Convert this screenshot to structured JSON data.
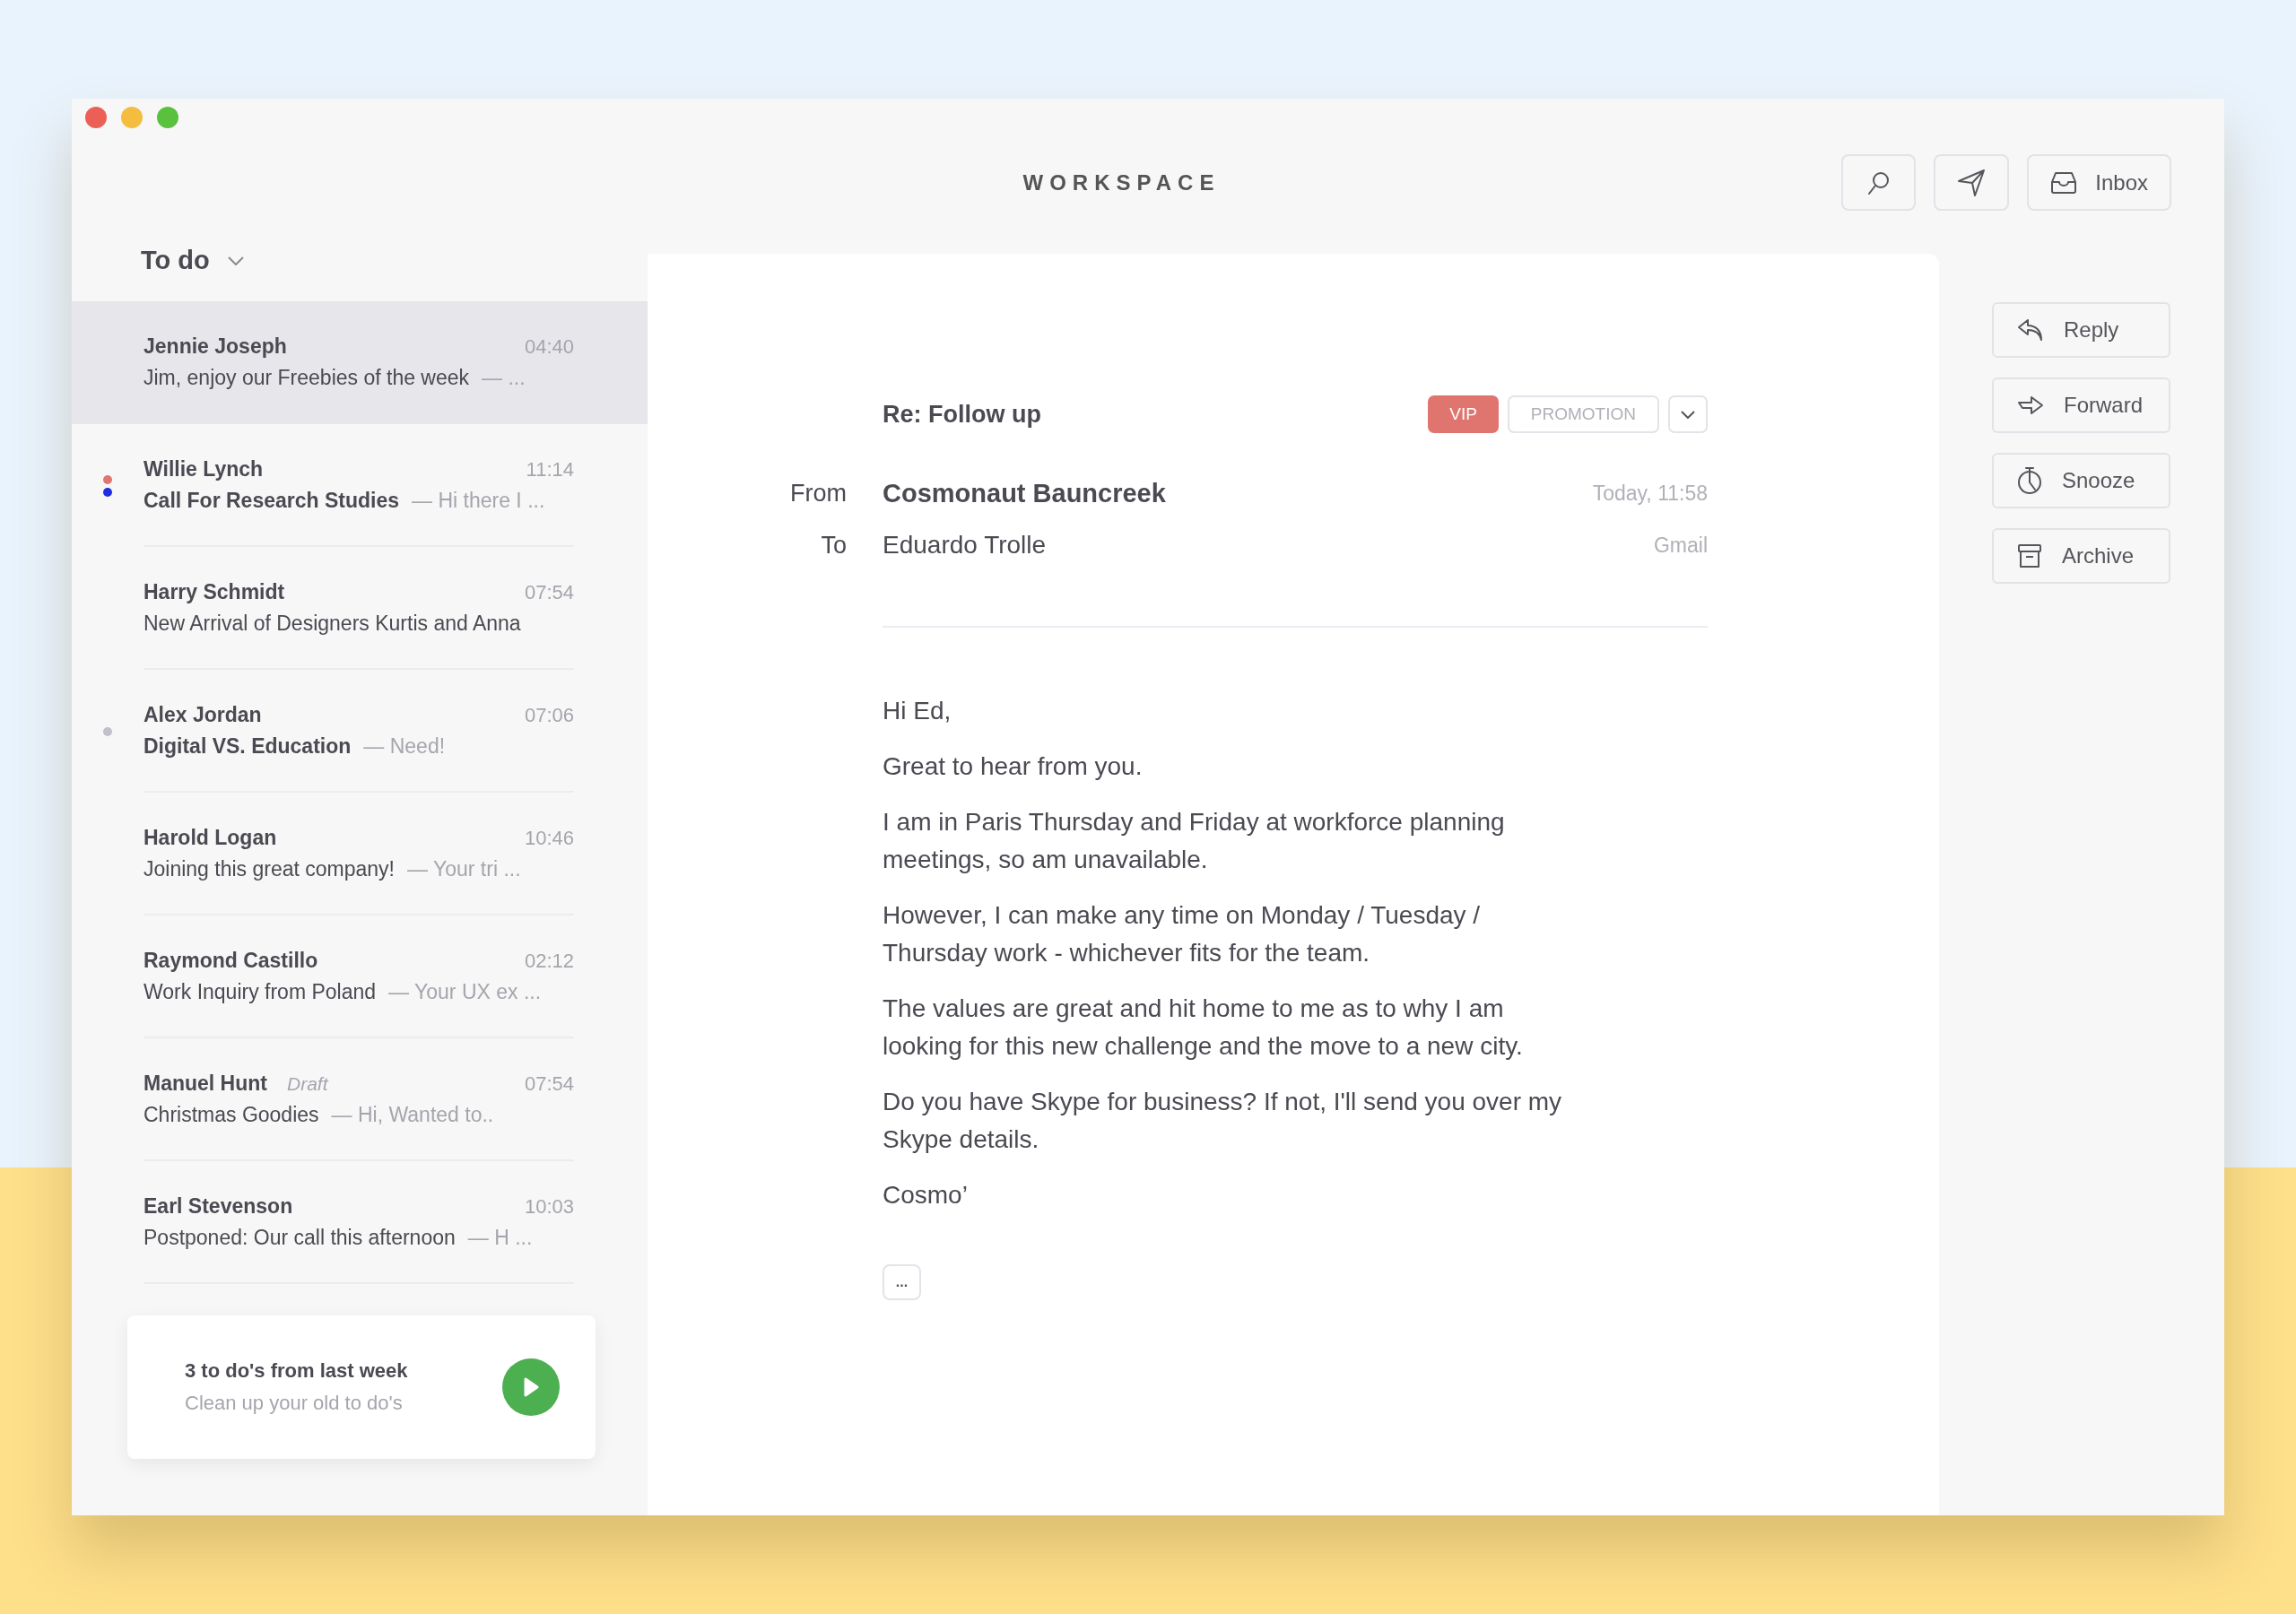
{
  "window": {
    "title": "WORKSPACE"
  },
  "header_buttons": [
    {
      "kind": "search"
    },
    {
      "kind": "send"
    },
    {
      "kind": "inbox",
      "label": "Inbox"
    }
  ],
  "sidebar": {
    "folder": "To do",
    "items": [
      {
        "name": "Jennie Joseph",
        "time": "04:40",
        "subject": "Jim, enjoy our Freebies of the week",
        "preview": "— ...",
        "unread": false,
        "selected": true
      },
      {
        "name": "Willie Lynch",
        "time": "11:14",
        "subject": "Call For Research Studies",
        "preview": "— Hi there I ...",
        "unread": true,
        "selected": false,
        "dots": [
          {
            "color": "#e07570"
          },
          {
            "color": "#1f2ee0"
          }
        ]
      },
      {
        "name": "Harry Schmidt",
        "time": "07:54",
        "subject": "New Arrival of Designers Kurtis and Anna",
        "unread": false,
        "selected": false
      },
      {
        "name": "Alex Jordan",
        "time": "07:06",
        "subject": "Digital VS. Education",
        "preview": "— Need!",
        "unread": true,
        "selected": false,
        "dots": [
          {
            "color": "#c0bfcc"
          }
        ]
      },
      {
        "name": "Harold Logan",
        "time": "10:46",
        "subject": "Joining this great company!",
        "preview": "— Your tri ...",
        "unread": false,
        "selected": false
      },
      {
        "name": "Raymond Castillo",
        "time": "02:12",
        "subject": "Work Inquiry from Poland",
        "preview": "— Your UX ex ...",
        "unread": false,
        "selected": false
      },
      {
        "name": "Manuel Hunt",
        "draft": "Draft",
        "time": "07:54",
        "subject": "Christmas Goodies",
        "preview": "— Hi, Wanted to..",
        "unread": false,
        "selected": false
      },
      {
        "name": "Earl Stevenson",
        "time": "10:03",
        "subject": "Postponed: Our call this afternoon",
        "preview": "— H ...",
        "unread": false,
        "selected": false
      }
    ],
    "reminder": {
      "title": "3 to do's from last week",
      "subtitle": "Clean up your old to do's"
    }
  },
  "message": {
    "subject": "Re: Follow up",
    "tags": [
      {
        "label": "VIP",
        "kind": "filled"
      },
      {
        "label": "PROMOTION",
        "kind": "outline"
      }
    ],
    "from_label": "From",
    "from": "Cosmonaut Bauncreek",
    "date": "Today, 11:58",
    "to_label": "To",
    "to": "Eduardo Trolle",
    "account": "Gmail",
    "body": [
      "Hi Ed,",
      "Great to hear from you.",
      "I am in Paris Thursday and Friday at workforce planning meetings, so am unavailable.",
      "However, I can make any time on Monday / Tuesday / Thursday work - whichever fits for the team.",
      "The values are great and hit home to me as to why I am looking for this new challenge and the move to a new city.",
      "Do you have Skype for business? If not, I'll send you over my Skype details.",
      "Cosmo’"
    ],
    "more": "..."
  },
  "actions": [
    {
      "kind": "reply",
      "label": "Reply"
    },
    {
      "kind": "forward",
      "label": "Forward"
    },
    {
      "kind": "snooze",
      "label": "Snooze"
    },
    {
      "kind": "archive",
      "label": "Archive"
    }
  ]
}
